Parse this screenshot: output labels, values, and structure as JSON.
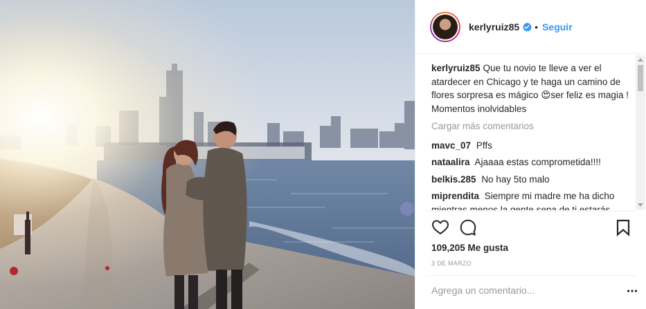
{
  "post": {
    "username": "kerlyruiz85",
    "follow_label": "Seguir",
    "dot": "•",
    "caption": {
      "user": "kerlyruiz85",
      "text_before_emoji": "Que tu novio te lleve a ver el atardecer en Chicago y te haga un camino de flores sorpresa es mágico ",
      "emoji": "😍",
      "text_after_emoji": "ser feliz es magia ! Momentos inolvidables"
    },
    "load_more": "Cargar más comentarios",
    "comments": [
      {
        "user": "mavc_07",
        "text": "Pffs"
      },
      {
        "user": "nataalira",
        "text": "Ajaaaa estas comprometida!!!!"
      },
      {
        "user": "belkis.285",
        "text": "No hay 5to malo"
      },
      {
        "user": "miprendita",
        "text": "Siempre mi madre me ha dicho mientras menos la gente sepa de ti estarás"
      }
    ],
    "likes": "109,205 Me gusta",
    "date": "3 DE MARZO",
    "add_comment_placeholder": "Agrega un comentario...",
    "icons": {
      "like": "heart-icon",
      "comment": "comment-bubble-icon",
      "save": "bookmark-icon",
      "verified": "verified-badge-icon",
      "more": "more-options-icon"
    },
    "colors": {
      "link": "#3897f0",
      "text": "#262626",
      "muted": "#999999",
      "border": "#efefef"
    }
  }
}
